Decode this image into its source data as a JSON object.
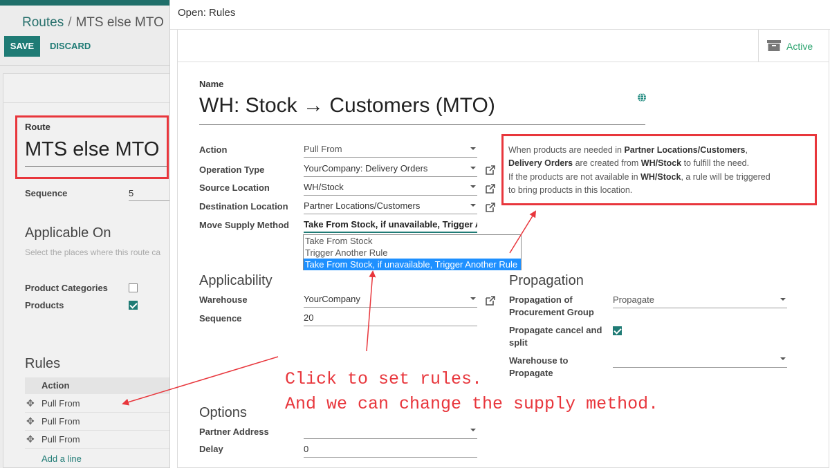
{
  "background": {
    "breadcrumb": {
      "parent": "Routes",
      "separator": "/",
      "current": "MTS else MTO"
    },
    "save_label": "SAVE",
    "discard_label": "DISCARD",
    "route_label": "Route",
    "route_value": "MTS else MTO",
    "sequence_label": "Sequence",
    "sequence_value": "5",
    "applicable_title": "Applicable On",
    "applicable_subtitle": "Select the places where this route ca",
    "product_categories_label": "Product Categories",
    "product_categories_checked": false,
    "products_label": "Products",
    "products_checked": true,
    "rules_title": "Rules",
    "rules_header": "Action",
    "rules": [
      "Pull From",
      "Pull From",
      "Pull From"
    ],
    "add_line": "Add a line"
  },
  "modal": {
    "title": "Open: Rules",
    "active_label": "Active",
    "name_label": "Name",
    "name_value": "WH: Stock → Customers (MTO)",
    "fields": {
      "action": {
        "label": "Action",
        "value": "Pull From"
      },
      "operation_type": {
        "label": "Operation Type",
        "value": "YourCompany: Delivery Orders"
      },
      "source_location": {
        "label": "Source Location",
        "value": "WH/Stock"
      },
      "destination_location": {
        "label": "Destination Location",
        "value": "Partner Locations/Customers"
      },
      "move_supply_method": {
        "label": "Move Supply Method",
        "value": "Take From Stock, if unavailable, Trigger An"
      }
    },
    "supply_options": [
      "Take From Stock",
      "Trigger Another Rule",
      "Take From Stock, if unavailable, Trigger Another Rule"
    ],
    "help": {
      "l1_a": "When products are needed in ",
      "l1_b": "Partner Locations/Customers",
      "l1_c": ",",
      "l2_a": "Delivery Orders",
      "l2_b": " are created from ",
      "l2_c": "WH/Stock",
      "l2_d": " to fulfill the need.",
      "l3_a": "If the products are not available in ",
      "l3_b": "WH/Stock",
      "l3_c": ", a rule will be triggered",
      "l4": "to bring products in this location."
    },
    "applicability": {
      "title": "Applicability",
      "warehouse_label": "Warehouse",
      "warehouse_value": "YourCompany",
      "sequence_label": "Sequence",
      "sequence_value": "20"
    },
    "propagation": {
      "title": "Propagation",
      "group_label_1": "Propagation of",
      "group_label_2": "Procurement Group",
      "group_value": "Propagate",
      "cancel_label_1": "Propagate cancel and",
      "cancel_label_2": "split",
      "cancel_checked": true,
      "warehouse_label_1": "Warehouse to",
      "warehouse_label_2": "Propagate",
      "warehouse_value": ""
    },
    "options": {
      "title": "Options",
      "partner_label": "Partner Address",
      "partner_value": "",
      "delay_label": "Delay",
      "delay_value": "0"
    }
  },
  "annotation": {
    "line1": "Click to set rules.",
    "line2": "And we can change the supply method."
  },
  "colors": {
    "accent": "#1f7b75",
    "highlight": "#e8363c",
    "selected": "#1e90ff",
    "active": "#2aa36e"
  }
}
